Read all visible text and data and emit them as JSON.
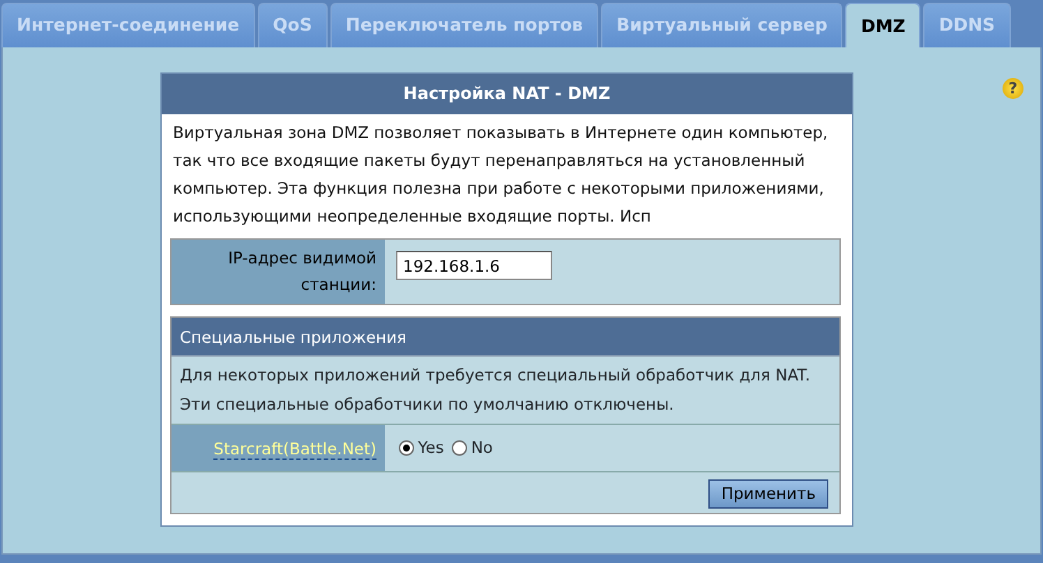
{
  "tabs": [
    {
      "label": "Интернет-соединение",
      "selected": false
    },
    {
      "label": "QoS",
      "selected": false
    },
    {
      "label": "Переключатель портов",
      "selected": false
    },
    {
      "label": "Виртуальный сервер",
      "selected": false
    },
    {
      "label": "DMZ",
      "selected": true
    },
    {
      "label": "DDNS",
      "selected": false
    }
  ],
  "help": "?",
  "panel": {
    "title": "Настройка NAT - DMZ",
    "description": "Виртуальная зона DMZ позволяет показывать в Интернете один компьютер, так что все входящие пакеты будут перенаправляться на установленный компьютер. Эта функция полезна при работе с некоторыми приложениями, использующими неопределенные входящие порты. Исп",
    "ip_field": {
      "label": "IP-адрес видимой станции:",
      "value": "192.168.1.6"
    },
    "special": {
      "title": "Специальные приложения",
      "description": "Для некоторых приложений требуется специальный обработчик для NAT. Эти специальные обработчики по умолчанию отключены.",
      "apps": [
        {
          "label": "Starcraft(Battle.Net)",
          "options": [
            {
              "label": "Yes",
              "selected": true
            },
            {
              "label": "No",
              "selected": false
            }
          ]
        }
      ]
    },
    "apply": "Применить"
  }
}
